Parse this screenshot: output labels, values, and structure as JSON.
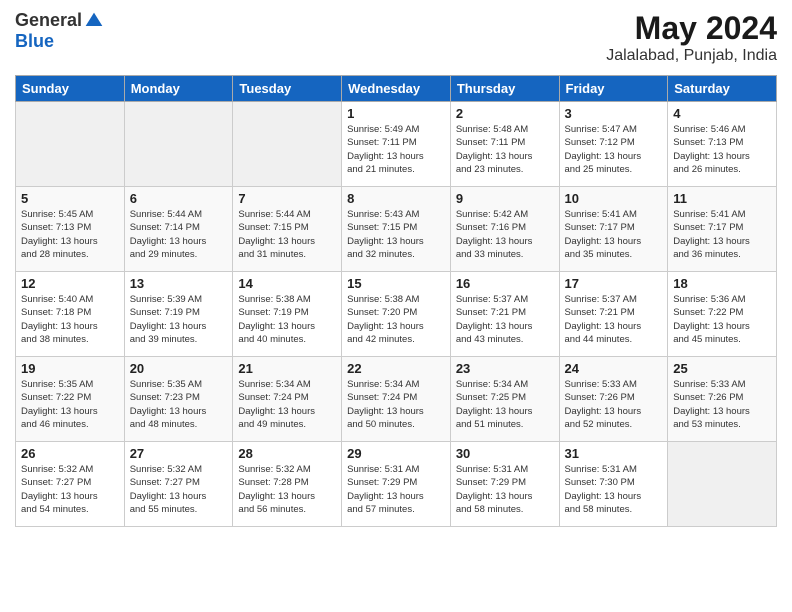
{
  "header": {
    "logo_general": "General",
    "logo_blue": "Blue",
    "month_year": "May 2024",
    "location": "Jalalabad, Punjab, India"
  },
  "weekdays": [
    "Sunday",
    "Monday",
    "Tuesday",
    "Wednesday",
    "Thursday",
    "Friday",
    "Saturday"
  ],
  "weeks": [
    [
      {
        "day": "",
        "info": ""
      },
      {
        "day": "",
        "info": ""
      },
      {
        "day": "",
        "info": ""
      },
      {
        "day": "1",
        "info": "Sunrise: 5:49 AM\nSunset: 7:11 PM\nDaylight: 13 hours\nand 21 minutes."
      },
      {
        "day": "2",
        "info": "Sunrise: 5:48 AM\nSunset: 7:11 PM\nDaylight: 13 hours\nand 23 minutes."
      },
      {
        "day": "3",
        "info": "Sunrise: 5:47 AM\nSunset: 7:12 PM\nDaylight: 13 hours\nand 25 minutes."
      },
      {
        "day": "4",
        "info": "Sunrise: 5:46 AM\nSunset: 7:13 PM\nDaylight: 13 hours\nand 26 minutes."
      }
    ],
    [
      {
        "day": "5",
        "info": "Sunrise: 5:45 AM\nSunset: 7:13 PM\nDaylight: 13 hours\nand 28 minutes."
      },
      {
        "day": "6",
        "info": "Sunrise: 5:44 AM\nSunset: 7:14 PM\nDaylight: 13 hours\nand 29 minutes."
      },
      {
        "day": "7",
        "info": "Sunrise: 5:44 AM\nSunset: 7:15 PM\nDaylight: 13 hours\nand 31 minutes."
      },
      {
        "day": "8",
        "info": "Sunrise: 5:43 AM\nSunset: 7:15 PM\nDaylight: 13 hours\nand 32 minutes."
      },
      {
        "day": "9",
        "info": "Sunrise: 5:42 AM\nSunset: 7:16 PM\nDaylight: 13 hours\nand 33 minutes."
      },
      {
        "day": "10",
        "info": "Sunrise: 5:41 AM\nSunset: 7:17 PM\nDaylight: 13 hours\nand 35 minutes."
      },
      {
        "day": "11",
        "info": "Sunrise: 5:41 AM\nSunset: 7:17 PM\nDaylight: 13 hours\nand 36 minutes."
      }
    ],
    [
      {
        "day": "12",
        "info": "Sunrise: 5:40 AM\nSunset: 7:18 PM\nDaylight: 13 hours\nand 38 minutes."
      },
      {
        "day": "13",
        "info": "Sunrise: 5:39 AM\nSunset: 7:19 PM\nDaylight: 13 hours\nand 39 minutes."
      },
      {
        "day": "14",
        "info": "Sunrise: 5:38 AM\nSunset: 7:19 PM\nDaylight: 13 hours\nand 40 minutes."
      },
      {
        "day": "15",
        "info": "Sunrise: 5:38 AM\nSunset: 7:20 PM\nDaylight: 13 hours\nand 42 minutes."
      },
      {
        "day": "16",
        "info": "Sunrise: 5:37 AM\nSunset: 7:21 PM\nDaylight: 13 hours\nand 43 minutes."
      },
      {
        "day": "17",
        "info": "Sunrise: 5:37 AM\nSunset: 7:21 PM\nDaylight: 13 hours\nand 44 minutes."
      },
      {
        "day": "18",
        "info": "Sunrise: 5:36 AM\nSunset: 7:22 PM\nDaylight: 13 hours\nand 45 minutes."
      }
    ],
    [
      {
        "day": "19",
        "info": "Sunrise: 5:35 AM\nSunset: 7:22 PM\nDaylight: 13 hours\nand 46 minutes."
      },
      {
        "day": "20",
        "info": "Sunrise: 5:35 AM\nSunset: 7:23 PM\nDaylight: 13 hours\nand 48 minutes."
      },
      {
        "day": "21",
        "info": "Sunrise: 5:34 AM\nSunset: 7:24 PM\nDaylight: 13 hours\nand 49 minutes."
      },
      {
        "day": "22",
        "info": "Sunrise: 5:34 AM\nSunset: 7:24 PM\nDaylight: 13 hours\nand 50 minutes."
      },
      {
        "day": "23",
        "info": "Sunrise: 5:34 AM\nSunset: 7:25 PM\nDaylight: 13 hours\nand 51 minutes."
      },
      {
        "day": "24",
        "info": "Sunrise: 5:33 AM\nSunset: 7:26 PM\nDaylight: 13 hours\nand 52 minutes."
      },
      {
        "day": "25",
        "info": "Sunrise: 5:33 AM\nSunset: 7:26 PM\nDaylight: 13 hours\nand 53 minutes."
      }
    ],
    [
      {
        "day": "26",
        "info": "Sunrise: 5:32 AM\nSunset: 7:27 PM\nDaylight: 13 hours\nand 54 minutes."
      },
      {
        "day": "27",
        "info": "Sunrise: 5:32 AM\nSunset: 7:27 PM\nDaylight: 13 hours\nand 55 minutes."
      },
      {
        "day": "28",
        "info": "Sunrise: 5:32 AM\nSunset: 7:28 PM\nDaylight: 13 hours\nand 56 minutes."
      },
      {
        "day": "29",
        "info": "Sunrise: 5:31 AM\nSunset: 7:29 PM\nDaylight: 13 hours\nand 57 minutes."
      },
      {
        "day": "30",
        "info": "Sunrise: 5:31 AM\nSunset: 7:29 PM\nDaylight: 13 hours\nand 58 minutes."
      },
      {
        "day": "31",
        "info": "Sunrise: 5:31 AM\nSunset: 7:30 PM\nDaylight: 13 hours\nand 58 minutes."
      },
      {
        "day": "",
        "info": ""
      }
    ]
  ]
}
